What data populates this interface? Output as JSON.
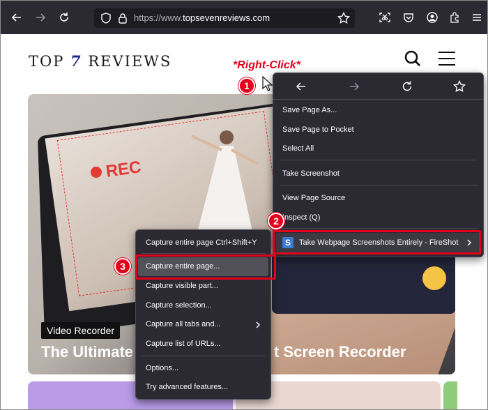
{
  "browser": {
    "url_prefix": "https://www.",
    "url_domain": "topsevenreviews.com",
    "icons": [
      "back-arrow-icon",
      "forward-arrow-icon",
      "reload-icon",
      "shield-icon",
      "lock-icon",
      "bookmark-star-icon",
      "screenshot-icon",
      "pocket-icon",
      "account-icon",
      "extensions-icon",
      "hamburger-menu-icon"
    ]
  },
  "site": {
    "logo_left": "TOP ",
    "logo_seven": "7",
    "logo_right": "REVIEWS",
    "hero": {
      "rec_label": "REC",
      "badge": "Video Recorder",
      "title_left": "The Ultimate",
      "title_right": "t Screen Recorder"
    }
  },
  "annotations": {
    "right_click_label": "*Right-Click*",
    "step1": "1",
    "step2": "2",
    "step3": "3",
    "color": "#e3001b"
  },
  "context_menu": {
    "items": [
      "Save Page As...",
      "Save Page to Pocket",
      "Select All",
      "Take Screenshot",
      "View Page Source",
      "Inspect (Q)"
    ],
    "fireshot_label": "Take Webpage Screenshots Entirely - FireShot",
    "fireshot_logo": "S"
  },
  "fireshot_submenu": {
    "items": [
      "Capture entire page Ctrl+Shift+Y",
      "Capture entire page...",
      "Capture visible part...",
      "Capture selection...",
      "Capture all tabs and...",
      "Capture list of URLs...",
      "Options...",
      "Try advanced features..."
    ]
  }
}
